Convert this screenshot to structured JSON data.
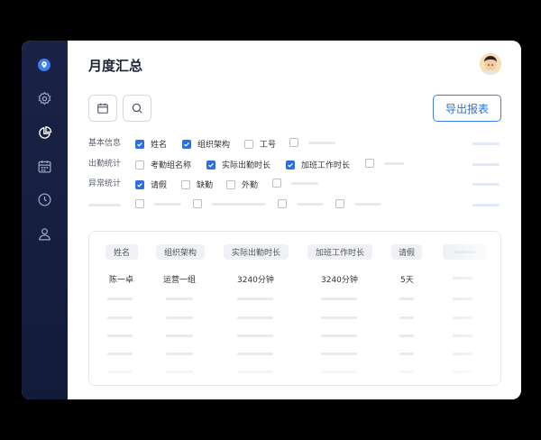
{
  "page": {
    "title": "月度汇总"
  },
  "toolbar": {
    "export_label": "导出报表"
  },
  "filters": {
    "basic": {
      "label": "基本信息",
      "options": [
        {
          "label": "姓名",
          "checked": true
        },
        {
          "label": "组织架构",
          "checked": true
        },
        {
          "label": "工号",
          "checked": false
        }
      ]
    },
    "attendance": {
      "label": "出勤统计",
      "options": [
        {
          "label": "考勤组名称",
          "checked": false
        },
        {
          "label": "实际出勤时长",
          "checked": true
        },
        {
          "label": "加班工作时长",
          "checked": true
        }
      ]
    },
    "abnormal": {
      "label": "异常统计",
      "options": [
        {
          "label": "请假",
          "checked": true
        },
        {
          "label": "缺勤",
          "checked": false
        },
        {
          "label": "外勤",
          "checked": false
        }
      ]
    }
  },
  "table": {
    "columns": [
      "姓名",
      "组织架构",
      "实际出勤时长",
      "加班工作时长",
      "请假"
    ],
    "rows": [
      [
        "陈一卓",
        "运营一组",
        "3240分钟",
        "3240分钟",
        "5天"
      ]
    ]
  },
  "colors": {
    "accent": "#2d6ee8",
    "sidebar": "#1a2347"
  }
}
